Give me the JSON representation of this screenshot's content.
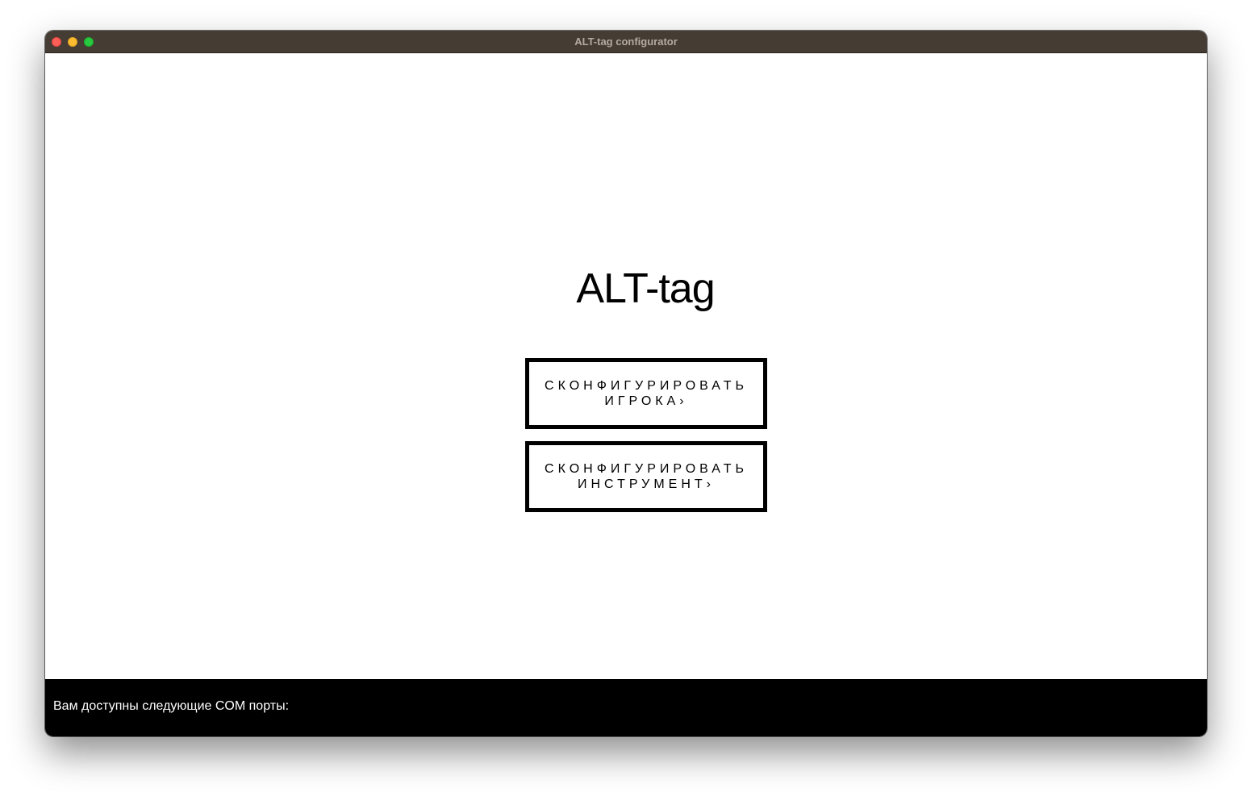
{
  "window": {
    "title": "ALT-tag configurator"
  },
  "main": {
    "title": "ALT-tag",
    "buttons": [
      {
        "label": "Сконфигурировать игрока›"
      },
      {
        "label": "Сконфигурировать инструмент›"
      }
    ]
  },
  "footer": {
    "ports_text": "Вам доступны следующие COM порты:"
  },
  "colors": {
    "titlebar": "#453c34",
    "background": "#ffffff",
    "footer": "#000000",
    "button_border": "#000000"
  }
}
